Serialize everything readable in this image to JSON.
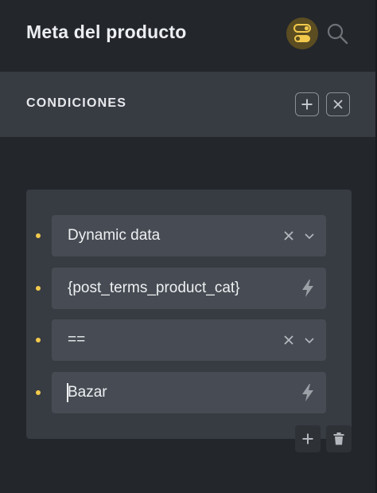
{
  "header": {
    "title": "Meta del producto",
    "icons": [
      "toggle-icon",
      "search-icon"
    ],
    "accent_color": "#f2c94c"
  },
  "section": {
    "title": "CONDICIONES",
    "icons": [
      "plus-icon",
      "close-icon"
    ]
  },
  "conditions": [
    {
      "value": "Dynamic data",
      "type": "select"
    },
    {
      "value": "{post_terms_product_cat}",
      "type": "dynamic-input"
    },
    {
      "value": "==",
      "type": "select"
    },
    {
      "value": "Bazar",
      "type": "dynamic-input"
    }
  ],
  "card_actions": {
    "icons": [
      "plus-icon",
      "trash-icon"
    ]
  }
}
